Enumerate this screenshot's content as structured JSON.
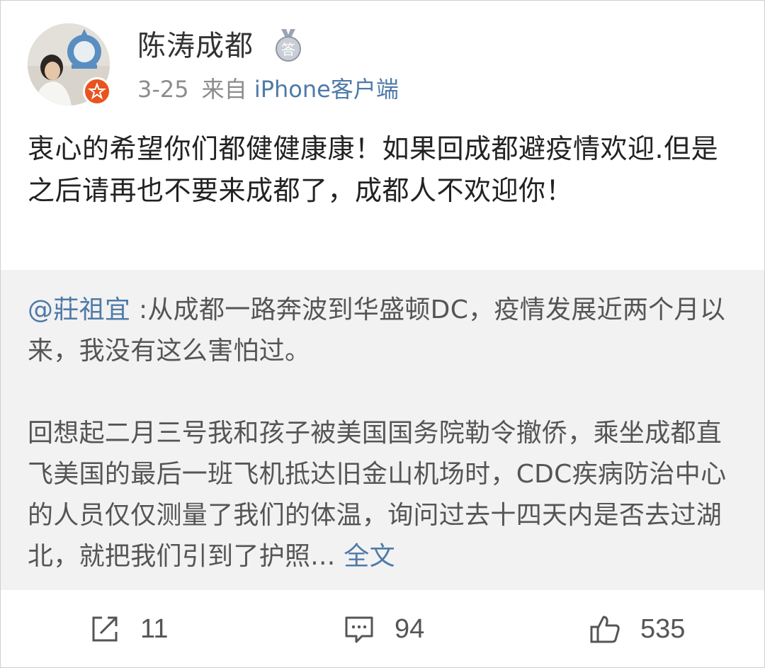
{
  "post": {
    "author": {
      "name": "陈涛成都",
      "medal_text": "答"
    },
    "date": "3-25",
    "source_prefix": "来自",
    "source_client": "iPhone客户端",
    "text": "衷心的希望你们都健健康康！如果回成都避疫情欢迎.但是之后请再也不要来成都了，成都人不欢迎你！"
  },
  "repost": {
    "mention": "@莊祖宜",
    "paragraph1": " :从成都一路奔波到华盛顿DC，疫情发展近两个月以来，我没有这么害怕过。",
    "paragraph2": "回想起二月三号我和孩子被美国国务院勒令撤侨，乘坐成都直飞美国的最后一班飞机抵达旧金山机场时，CDC疾病防治中心的人员仅仅测量了我们的体温，询问过去十四天内是否去过湖北，就把我们引到了护照... ",
    "expand_label": "全文"
  },
  "actions": {
    "repost_count": "11",
    "comment_count": "94",
    "like_count": "535"
  },
  "colors": {
    "link": "#4f7aa8",
    "repost_bg": "#f2f2f2",
    "badge": "#e8541e"
  },
  "icons": {
    "badge": "verified-star-badge-icon",
    "medal": "medal-answer-icon",
    "repost": "repost-share-icon",
    "comment": "comment-icon",
    "like": "thumbs-up-icon"
  }
}
